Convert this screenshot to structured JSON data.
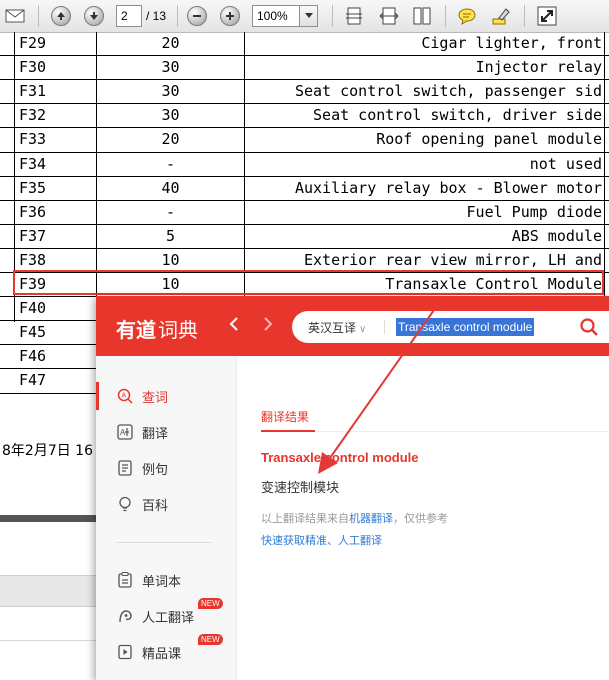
{
  "toolbar": {
    "page_current": "2",
    "page_total": "/ 13",
    "zoom": "100%"
  },
  "table": {
    "rows": [
      {
        "fuse": "F29",
        "amp": "20",
        "desc": "Cigar lighter, front"
      },
      {
        "fuse": "F30",
        "amp": "30",
        "desc": "Injector relay"
      },
      {
        "fuse": "F31",
        "amp": "30",
        "desc": "Seat control switch, passenger sid"
      },
      {
        "fuse": "F32",
        "amp": "30",
        "desc": "Seat control switch, driver side"
      },
      {
        "fuse": "F33",
        "amp": "20",
        "desc": "Roof opening panel module"
      },
      {
        "fuse": "F34",
        "amp": "-",
        "desc": "not used"
      },
      {
        "fuse": "F35",
        "amp": "40",
        "desc": "Auxiliary relay box - Blower motor"
      },
      {
        "fuse": "F36",
        "amp": "-",
        "desc": "Fuel Pump diode"
      },
      {
        "fuse": "F37",
        "amp": "5",
        "desc": "ABS module"
      },
      {
        "fuse": "F38",
        "amp": "10",
        "desc": "Exterior rear view mirror, LH and"
      },
      {
        "fuse": "F39",
        "amp": "10",
        "desc": "Transaxle Control Module"
      },
      {
        "fuse": "F40",
        "amp": "",
        "desc": ""
      },
      {
        "fuse": "F45",
        "amp": "",
        "desc": ""
      },
      {
        "fuse": "F46",
        "amp": "",
        "desc": ""
      },
      {
        "fuse": "F47",
        "amp": "",
        "desc": ""
      }
    ],
    "date_fragment": "8年2月7日  16"
  },
  "youdao": {
    "logo_main": "有道",
    "logo_sub": "词典",
    "lang_select": "英汉互译",
    "query": "Transaxle control module",
    "sidebar": [
      {
        "label": "查词",
        "icon": "search-a-icon"
      },
      {
        "label": "翻译",
        "icon": "translate-icon"
      },
      {
        "label": "例句",
        "icon": "example-icon"
      },
      {
        "label": "百科",
        "icon": "bulb-icon"
      },
      {
        "label": "单词本",
        "icon": "wordbook-icon"
      },
      {
        "label": "人工翻译",
        "icon": "human-translate-icon",
        "badge": "NEW"
      },
      {
        "label": "精品课",
        "icon": "course-icon",
        "badge": "NEW"
      }
    ],
    "result": {
      "section_title": "翻译结果",
      "term": "Transaxle control module",
      "translation": "变速控制模块",
      "note_prefix": "以上翻译结果来自",
      "note_link": "机器翻译",
      "note_suffix": "，仅供参考",
      "quick_link": "快速获取精准、人工翻译"
    },
    "colors": {
      "brand": "#e8362d",
      "link": "#2f7dd6"
    }
  }
}
